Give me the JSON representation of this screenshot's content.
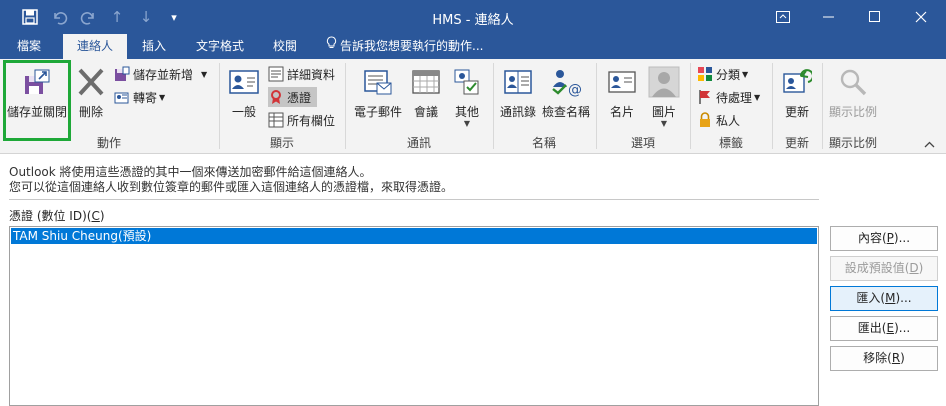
{
  "window": {
    "title": "HMS - 連絡人",
    "quick_access_icons": [
      "save-icon",
      "undo-icon",
      "redo-icon",
      "up-arrow-icon",
      "down-arrow-icon",
      "customize-icon"
    ],
    "controls": [
      "ribbon-display-icon",
      "minimize-icon",
      "maximize-icon",
      "close-icon"
    ]
  },
  "tabs": [
    {
      "label": "檔案"
    },
    {
      "label": "連絡人",
      "active": true
    },
    {
      "label": "插入"
    },
    {
      "label": "文字格式"
    },
    {
      "label": "校閱"
    }
  ],
  "tell_me": "告訴我您想要執行的動作...",
  "ribbon": {
    "groups": {
      "actions": "動作",
      "show": "顯示",
      "communicate": "通訊",
      "names": "名稱",
      "options": "選項",
      "tags": "標籤",
      "update": "更新",
      "zoom": "顯示比例"
    },
    "actions": {
      "save_close": "儲存並關閉",
      "delete": "刪除",
      "save_new": "儲存並新增",
      "forward": "轉寄"
    },
    "show": {
      "general": "一般",
      "details": "詳細資料",
      "certificates": "憑證",
      "all_fields": "所有欄位"
    },
    "communicate": {
      "email": "電子郵件",
      "meeting": "會議",
      "more": "其他"
    },
    "names": {
      "address_book": "通訊錄",
      "check_names": "檢查名稱"
    },
    "options": {
      "business_card": "名片",
      "picture": "圖片"
    },
    "tags": {
      "categorize": "分類",
      "follow_up": "待處理",
      "private": "私人"
    },
    "update": {
      "update": "更新"
    },
    "zoom": {
      "zoom": "顯示比例"
    }
  },
  "content": {
    "info_line1": "Outlook 將使用這些憑證的其中一個來傳送加密郵件給這個連絡人。",
    "info_line2": "您可以從這個連絡人收到數位簽章的郵件或匯入這個連絡人的憑證檔，來取得憑證。",
    "cert_label_prefix": "憑證 (數位 ID)(",
    "cert_label_key": "C",
    "cert_label_suffix": ")",
    "certificates": [
      "TAM Shiu Cheung(預設)"
    ],
    "buttons": {
      "properties": {
        "prefix": "內容(",
        "key": "P",
        "suffix": ")..."
      },
      "set_default": {
        "prefix": "設成預設值(",
        "key": "D",
        "suffix": ")"
      },
      "import": {
        "prefix": "匯入(",
        "key": "M",
        "suffix": ")..."
      },
      "export": {
        "prefix": "匯出(",
        "key": "E",
        "suffix": ")..."
      },
      "remove": {
        "prefix": "移除(",
        "key": "R",
        "suffix": ")"
      }
    }
  },
  "colors": {
    "title_bar": "#2b579a",
    "ribbon_bg": "#f3f3f3",
    "selection": "#0078d7",
    "highlight_box": "#1ea838"
  }
}
